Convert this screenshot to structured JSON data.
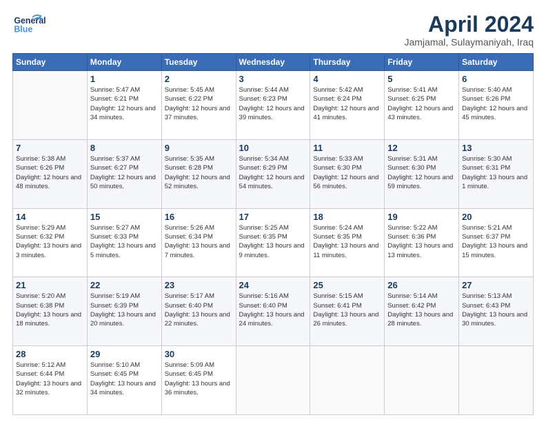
{
  "header": {
    "logo_line1": "General",
    "logo_line2": "Blue",
    "title": "April 2024",
    "subtitle": "Jamjamal, Sulaymaniyah, Iraq"
  },
  "weekdays": [
    "Sunday",
    "Monday",
    "Tuesday",
    "Wednesday",
    "Thursday",
    "Friday",
    "Saturday"
  ],
  "weeks": [
    [
      {
        "day": "",
        "info": ""
      },
      {
        "day": "1",
        "info": "Sunrise: 5:47 AM\nSunset: 6:21 PM\nDaylight: 12 hours\nand 34 minutes."
      },
      {
        "day": "2",
        "info": "Sunrise: 5:45 AM\nSunset: 6:22 PM\nDaylight: 12 hours\nand 37 minutes."
      },
      {
        "day": "3",
        "info": "Sunrise: 5:44 AM\nSunset: 6:23 PM\nDaylight: 12 hours\nand 39 minutes."
      },
      {
        "day": "4",
        "info": "Sunrise: 5:42 AM\nSunset: 6:24 PM\nDaylight: 12 hours\nand 41 minutes."
      },
      {
        "day": "5",
        "info": "Sunrise: 5:41 AM\nSunset: 6:25 PM\nDaylight: 12 hours\nand 43 minutes."
      },
      {
        "day": "6",
        "info": "Sunrise: 5:40 AM\nSunset: 6:26 PM\nDaylight: 12 hours\nand 45 minutes."
      }
    ],
    [
      {
        "day": "7",
        "info": "Sunrise: 5:38 AM\nSunset: 6:26 PM\nDaylight: 12 hours\nand 48 minutes."
      },
      {
        "day": "8",
        "info": "Sunrise: 5:37 AM\nSunset: 6:27 PM\nDaylight: 12 hours\nand 50 minutes."
      },
      {
        "day": "9",
        "info": "Sunrise: 5:35 AM\nSunset: 6:28 PM\nDaylight: 12 hours\nand 52 minutes."
      },
      {
        "day": "10",
        "info": "Sunrise: 5:34 AM\nSunset: 6:29 PM\nDaylight: 12 hours\nand 54 minutes."
      },
      {
        "day": "11",
        "info": "Sunrise: 5:33 AM\nSunset: 6:30 PM\nDaylight: 12 hours\nand 56 minutes."
      },
      {
        "day": "12",
        "info": "Sunrise: 5:31 AM\nSunset: 6:30 PM\nDaylight: 12 hours\nand 59 minutes."
      },
      {
        "day": "13",
        "info": "Sunrise: 5:30 AM\nSunset: 6:31 PM\nDaylight: 13 hours\nand 1 minute."
      }
    ],
    [
      {
        "day": "14",
        "info": "Sunrise: 5:29 AM\nSunset: 6:32 PM\nDaylight: 13 hours\nand 3 minutes."
      },
      {
        "day": "15",
        "info": "Sunrise: 5:27 AM\nSunset: 6:33 PM\nDaylight: 13 hours\nand 5 minutes."
      },
      {
        "day": "16",
        "info": "Sunrise: 5:26 AM\nSunset: 6:34 PM\nDaylight: 13 hours\nand 7 minutes."
      },
      {
        "day": "17",
        "info": "Sunrise: 5:25 AM\nSunset: 6:35 PM\nDaylight: 13 hours\nand 9 minutes."
      },
      {
        "day": "18",
        "info": "Sunrise: 5:24 AM\nSunset: 6:35 PM\nDaylight: 13 hours\nand 11 minutes."
      },
      {
        "day": "19",
        "info": "Sunrise: 5:22 AM\nSunset: 6:36 PM\nDaylight: 13 hours\nand 13 minutes."
      },
      {
        "day": "20",
        "info": "Sunrise: 5:21 AM\nSunset: 6:37 PM\nDaylight: 13 hours\nand 15 minutes."
      }
    ],
    [
      {
        "day": "21",
        "info": "Sunrise: 5:20 AM\nSunset: 6:38 PM\nDaylight: 13 hours\nand 18 minutes."
      },
      {
        "day": "22",
        "info": "Sunrise: 5:19 AM\nSunset: 6:39 PM\nDaylight: 13 hours\nand 20 minutes."
      },
      {
        "day": "23",
        "info": "Sunrise: 5:17 AM\nSunset: 6:40 PM\nDaylight: 13 hours\nand 22 minutes."
      },
      {
        "day": "24",
        "info": "Sunrise: 5:16 AM\nSunset: 6:40 PM\nDaylight: 13 hours\nand 24 minutes."
      },
      {
        "day": "25",
        "info": "Sunrise: 5:15 AM\nSunset: 6:41 PM\nDaylight: 13 hours\nand 26 minutes."
      },
      {
        "day": "26",
        "info": "Sunrise: 5:14 AM\nSunset: 6:42 PM\nDaylight: 13 hours\nand 28 minutes."
      },
      {
        "day": "27",
        "info": "Sunrise: 5:13 AM\nSunset: 6:43 PM\nDaylight: 13 hours\nand 30 minutes."
      }
    ],
    [
      {
        "day": "28",
        "info": "Sunrise: 5:12 AM\nSunset: 6:44 PM\nDaylight: 13 hours\nand 32 minutes."
      },
      {
        "day": "29",
        "info": "Sunrise: 5:10 AM\nSunset: 6:45 PM\nDaylight: 13 hours\nand 34 minutes."
      },
      {
        "day": "30",
        "info": "Sunrise: 5:09 AM\nSunset: 6:45 PM\nDaylight: 13 hours\nand 36 minutes."
      },
      {
        "day": "",
        "info": ""
      },
      {
        "day": "",
        "info": ""
      },
      {
        "day": "",
        "info": ""
      },
      {
        "day": "",
        "info": ""
      }
    ]
  ]
}
